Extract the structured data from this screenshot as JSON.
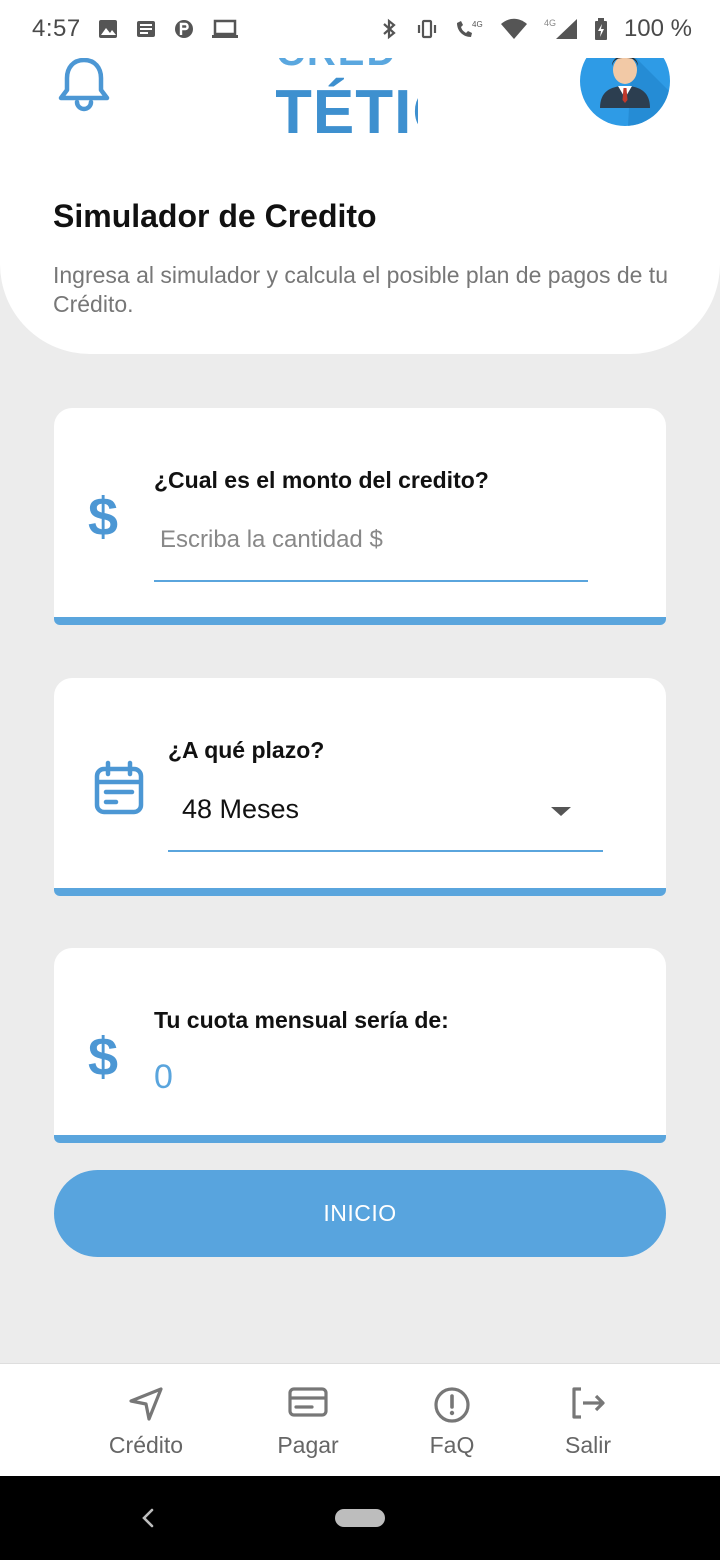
{
  "status_bar": {
    "time": "4:57",
    "battery": "100 %",
    "network_label": "4G",
    "icons_left": [
      "image-icon",
      "news-icon",
      "p-icon",
      "laptop-icon"
    ],
    "icons_right": [
      "bluetooth-icon",
      "vibrate-icon",
      "call-4g-icon",
      "wifi-icon",
      "signal-icon",
      "battery-icon"
    ]
  },
  "header": {
    "logo_top_text": "CRED",
    "logo_main_text": "TÉTIC",
    "title": "Simulador de Credito",
    "subtitle": "Ingresa al simulador y calcula el posible plan de pagos de tu Crédito."
  },
  "amount_card": {
    "label": "¿Cual es el monto del credito?",
    "currency_symbol": "$",
    "value": "",
    "placeholder": "Escriba la cantidad $"
  },
  "term_card": {
    "label": "¿A qué plazo?",
    "selected": "48 Meses"
  },
  "result_card": {
    "label": "Tu cuota mensual sería de:",
    "currency_symbol": "$",
    "value": "0"
  },
  "start_button": {
    "label": "INICIO"
  },
  "bottom_nav": {
    "items": [
      {
        "label": "Crédito",
        "icon": "navigation-arrow-icon"
      },
      {
        "label": "Pagar",
        "icon": "credit-card-icon"
      },
      {
        "label": "FaQ",
        "icon": "alert-circle-icon"
      },
      {
        "label": "Salir",
        "icon": "logout-icon"
      }
    ]
  },
  "colors": {
    "accent": "#5aa5dd",
    "background": "#ececec",
    "card": "#ffffff",
    "icon_blue": "#4c97d4"
  }
}
